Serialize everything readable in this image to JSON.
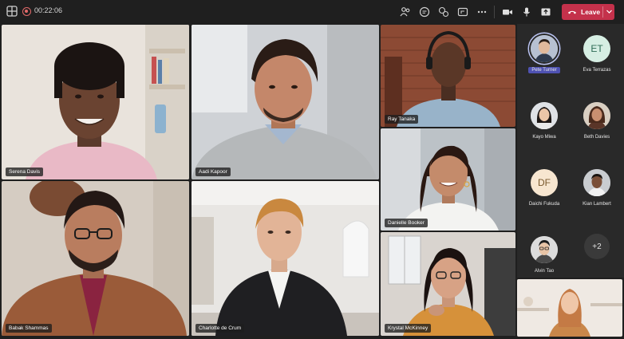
{
  "toolbar": {
    "timer": "00:22:06",
    "leave_label": "Leave",
    "leave_color": "#c4314b"
  },
  "tiles": [
    {
      "name": "Serena Davis"
    },
    {
      "name": "Aadi Kapoor"
    },
    {
      "name": "Ray Tanaka"
    },
    {
      "name": "Danielle Booker"
    },
    {
      "name": "Babak Shammas"
    },
    {
      "name": "Charlotte de Crum"
    },
    {
      "name": "Krystal McKinney"
    }
  ],
  "roster": {
    "people": [
      {
        "name": "Pete Turner",
        "initials": ""
      },
      {
        "name": "Eva Terrazas",
        "initials": "ET"
      },
      {
        "name": "Kayo Miwa",
        "initials": ""
      },
      {
        "name": "Beth Davies",
        "initials": ""
      },
      {
        "name": "Daichi Fukuda",
        "initials": "DF"
      },
      {
        "name": "Kian Lambert",
        "initials": ""
      },
      {
        "name": "Alvin Tao",
        "initials": ""
      }
    ],
    "overflow": "+2"
  },
  "icons": [
    "grid-icon",
    "record-icon",
    "people-icon",
    "chat-icon",
    "reactions-icon",
    "share-icon",
    "more-icon",
    "camera-icon",
    "mic-icon",
    "share-tray-icon",
    "phone-icon",
    "chevron-down-icon"
  ]
}
